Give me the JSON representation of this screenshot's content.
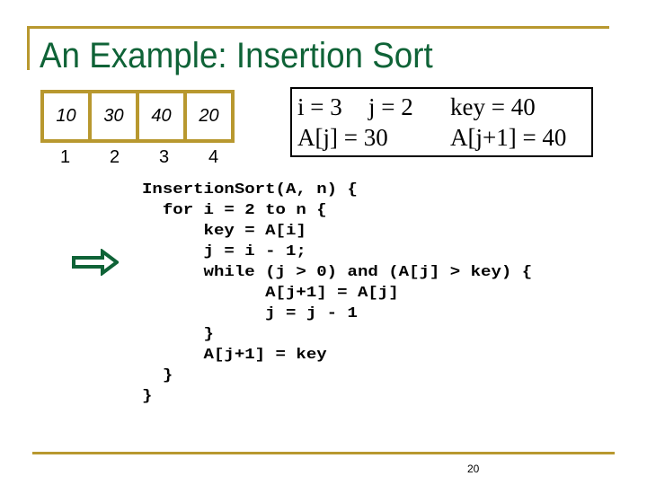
{
  "slide": {
    "title": "An Example: Insertion Sort",
    "page_number": "20"
  },
  "array": {
    "values": [
      "10",
      "30",
      "40",
      "20"
    ],
    "indices": [
      "1",
      "2",
      "3",
      "4"
    ]
  },
  "state": {
    "i": "i = 3",
    "j": "j = 2",
    "key": "key = 40",
    "a_j": "A[j] = 30",
    "a_j1": "A[j+1] = 40"
  },
  "code": {
    "lines": [
      "InsertionSort(A, n) {",
      "  for i = 2 to n {",
      "      key = A[i]",
      "      j = i - 1;",
      "      while (j > 0) and (A[j] > key) {",
      "            A[j+1] = A[j]",
      "            j = j - 1",
      "      }",
      "      A[j+1] = key",
      "  }",
      "}"
    ],
    "current_line_marker": "right-arrow-icon"
  },
  "colors": {
    "accent_gold": "#b8982f",
    "title_green": "#0f6337"
  }
}
